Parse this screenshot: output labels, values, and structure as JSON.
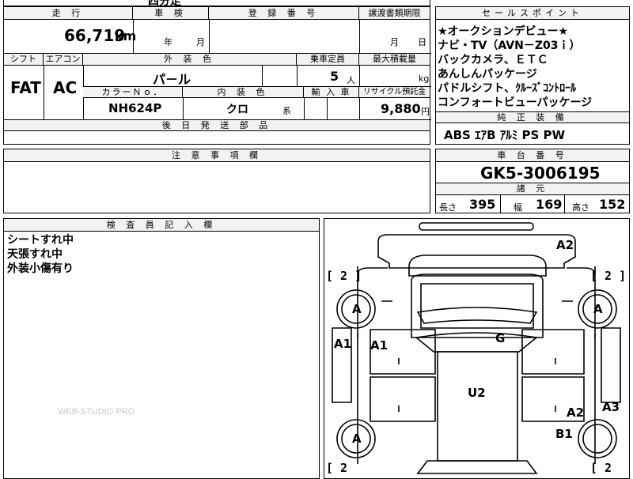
{
  "top_fragment": "四分走",
  "mileage": {
    "header": "走 行",
    "value": "66,719",
    "unit": "km"
  },
  "shaken": {
    "header": "車 検",
    "year_label": "年",
    "month_label": "月"
  },
  "registration": {
    "header": "登 録 番 号"
  },
  "transfer": {
    "header": "譲渡書類期限",
    "month_label": "月",
    "day_label": "日"
  },
  "sale_points": {
    "header": "セールスポイント",
    "lines": [
      "★オークションデビュー★",
      "ナビ・TV（AVN－Z03ｉ）",
      "バックカメラ、ＥＴＣ",
      "あんしんパッケージ",
      "パドルシフト、ｸﾙｰｽﾞｺﾝﾄﾛｰﾙ",
      "コンフォートビューパッケージ"
    ]
  },
  "shift": {
    "header": "シフト",
    "value": "FAT"
  },
  "aircon": {
    "header": "エアコン",
    "value": "AC"
  },
  "exterior": {
    "header": "外 装 色",
    "value": "パ－ル"
  },
  "capacity": {
    "header": "乗車定員",
    "value": "5",
    "unit": "人"
  },
  "max_load": {
    "header": "最大積載量",
    "unit": "kg"
  },
  "color_no": {
    "header": "カラーＮｏ．",
    "value": "NH624P"
  },
  "interior": {
    "header": "内 装 色",
    "value": "クロ",
    "suffix": "系"
  },
  "import": {
    "header": "輸 入 車"
  },
  "recycle": {
    "header": "リサイクル預託金",
    "value": "9,880",
    "unit": "円"
  },
  "later_parts": {
    "header": "後 日 発 送 部 品"
  },
  "equipment": {
    "header": "純 正 装 備",
    "value": "ABS ｴｱB ｱﾙﾐ PS PW"
  },
  "notes": {
    "header": "注 意 事 項 欄"
  },
  "chassis": {
    "header": "車 台 番 号",
    "value": "GK5-3006195"
  },
  "specs": {
    "header": "諸 元",
    "length_label": "長さ",
    "length": "395",
    "width_label": "幅",
    "width": "169",
    "height_label": "高さ",
    "height": "152"
  },
  "inspector": {
    "header": "検 査 員 記 入 欄",
    "lines": [
      "シートすれ中",
      "天張すれ中",
      "外装小傷有り"
    ]
  },
  "watermark": "WEB-STUDIO.PRO",
  "diagram": {
    "marks": {
      "a2_top": "A2",
      "tire_fl": "A",
      "tire_fr": "A",
      "tire_rl": "A",
      "a1_left": "A1",
      "a1_inner": "A1",
      "g": "G",
      "u2": "U2",
      "a2_right": "A2",
      "a3": "A3",
      "b1": "B1"
    },
    "brackets": [
      "[ 2 ]",
      "[ 2 ]",
      "[ 2",
      "[ 2"
    ]
  }
}
